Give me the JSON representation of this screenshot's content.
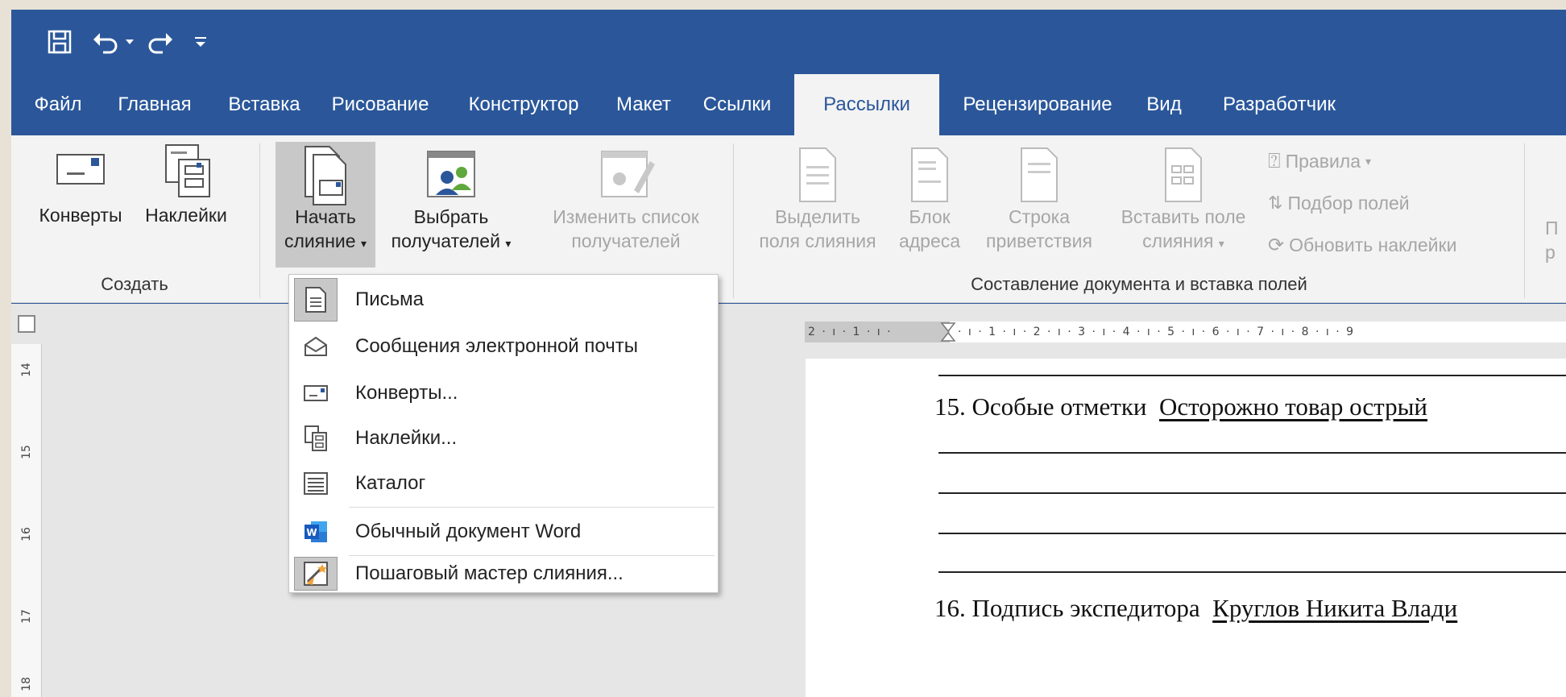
{
  "quick_access": {
    "icons": [
      "save-icon",
      "undo-icon",
      "undo-dropdown-icon",
      "redo-icon",
      "customize-qat-icon"
    ]
  },
  "tabs": [
    {
      "label": "Файл"
    },
    {
      "label": "Главная"
    },
    {
      "label": "Вставка"
    },
    {
      "label": "Рисование"
    },
    {
      "label": "Конструктор"
    },
    {
      "label": "Макет"
    },
    {
      "label": "Ссылки"
    },
    {
      "label": "Рассылки",
      "active": true
    },
    {
      "label": "Рецензирование"
    },
    {
      "label": "Вид"
    },
    {
      "label": "Разработчик"
    }
  ],
  "ribbon": {
    "create_group": {
      "label": "Создать",
      "envelopes": "Конверты",
      "labels": "Наклейки"
    },
    "start_group": {
      "start_merge_1": "Начать",
      "start_merge_2": "слияние",
      "select_recipients_1": "Выбрать",
      "select_recipients_2": "получателей",
      "edit_list_1": "Изменить список",
      "edit_list_2": "получателей"
    },
    "write_group": {
      "label": "Составление документа и вставка полей",
      "highlight_1": "Выделить",
      "highlight_2": "поля слияния",
      "address_1": "Блок",
      "address_2": "адреса",
      "greeting_1": "Строка",
      "greeting_2": "приветствия",
      "insert_field_1": "Вставить поле",
      "insert_field_2": "слияния",
      "rules": "Правила",
      "match_fields": "Подбор полей",
      "update_labels": "Обновить наклейки"
    },
    "cut_off": {
      "top": "П",
      "bottom": "р"
    }
  },
  "ruler": {
    "horizontal": "2 · ı · 1 · ı ·",
    "horizontal_right": "· ı · 1 · ı · 2 · ı · 3 · ı · 4 · ı · 5 · ı · 6 · ı · 7 · ı · 8 · ı · 9",
    "vertical": [
      "14",
      "15",
      "16",
      "17",
      "18"
    ]
  },
  "document": {
    "line1_label": "15. Особые отметки",
    "line1_value": "Осторожно товар острый",
    "line2_label": "16. Подпись экспедитора",
    "line2_value": "Круглов Никита Влади"
  },
  "menu": {
    "items": [
      {
        "label": "Письма",
        "icon": "letter-icon"
      },
      {
        "label": "Сообщения электронной почты",
        "icon": "email-icon"
      },
      {
        "label": "Конверты...",
        "icon": "envelope-icon"
      },
      {
        "label": "Наклейки...",
        "icon": "labels-icon"
      },
      {
        "label": "Каталог",
        "icon": "directory-icon"
      },
      {
        "label": "Обычный документ Word",
        "icon": "word-icon"
      },
      {
        "label": "Пошаговый мастер слияния...",
        "icon": "wizard-icon"
      }
    ]
  },
  "colors": {
    "accent": "#2b579a",
    "ribbon_bg": "#f3f3f3",
    "disabled_text": "#a6a6a6",
    "pressed_bg": "#c8c8c8"
  }
}
